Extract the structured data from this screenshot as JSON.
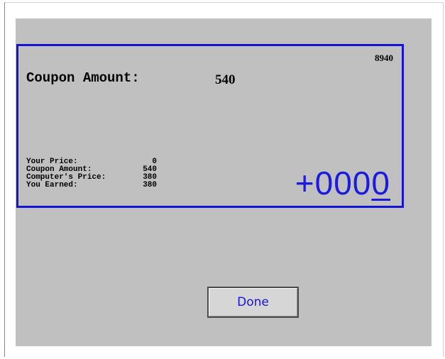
{
  "panel": {
    "corner_number": "8940",
    "coupon_label": "Coupon Amount:",
    "coupon_value": "540",
    "summary": [
      {
        "label": "Your Price:",
        "value": "0"
      },
      {
        "label": "Coupon Amount:",
        "value": "540"
      },
      {
        "label": "Computer's Price:",
        "value": "380"
      },
      {
        "label": "You Earned:",
        "value": "380"
      }
    ],
    "big_number_prefix": "+000",
    "big_number_cursor_digit": "0"
  },
  "buttons": {
    "done_label": "Done"
  },
  "colors": {
    "panel_border": "#1414d2",
    "accent_text": "#1a1ae0",
    "screen_background": "#c0c0c0"
  }
}
